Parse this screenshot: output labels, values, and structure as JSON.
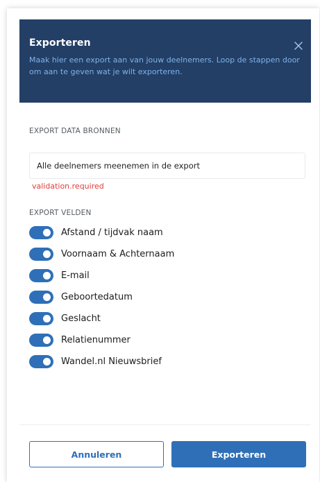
{
  "dialog": {
    "title": "Exporteren",
    "description": "Maak hier een export aan van jouw deelnemers. Loop de stappen door om aan te geven wat je wilt exporteren."
  },
  "sources": {
    "label": "EXPORT DATA BRONNEN",
    "option": "Alle deelnemers meenemen in de export",
    "validation": "validation.required"
  },
  "fields": {
    "label": "EXPORT VELDEN",
    "items": [
      {
        "label": "Afstand / tijdvak naam",
        "enabled": true
      },
      {
        "label": "Voornaam & Achternaam",
        "enabled": true
      },
      {
        "label": "E-mail",
        "enabled": true
      },
      {
        "label": "Geboortedatum",
        "enabled": true
      },
      {
        "label": "Geslacht",
        "enabled": true
      },
      {
        "label": "Relatienummer",
        "enabled": true
      },
      {
        "label": "Wandel.nl Nieuwsbrief",
        "enabled": true
      }
    ]
  },
  "footer": {
    "cancel_label": "Annuleren",
    "export_label": "Exporteren"
  },
  "colors": {
    "header_bg": "#233f66",
    "header_subtext": "#7fb2e8",
    "accent": "#2f6fb7",
    "error": "#e23b3b"
  }
}
